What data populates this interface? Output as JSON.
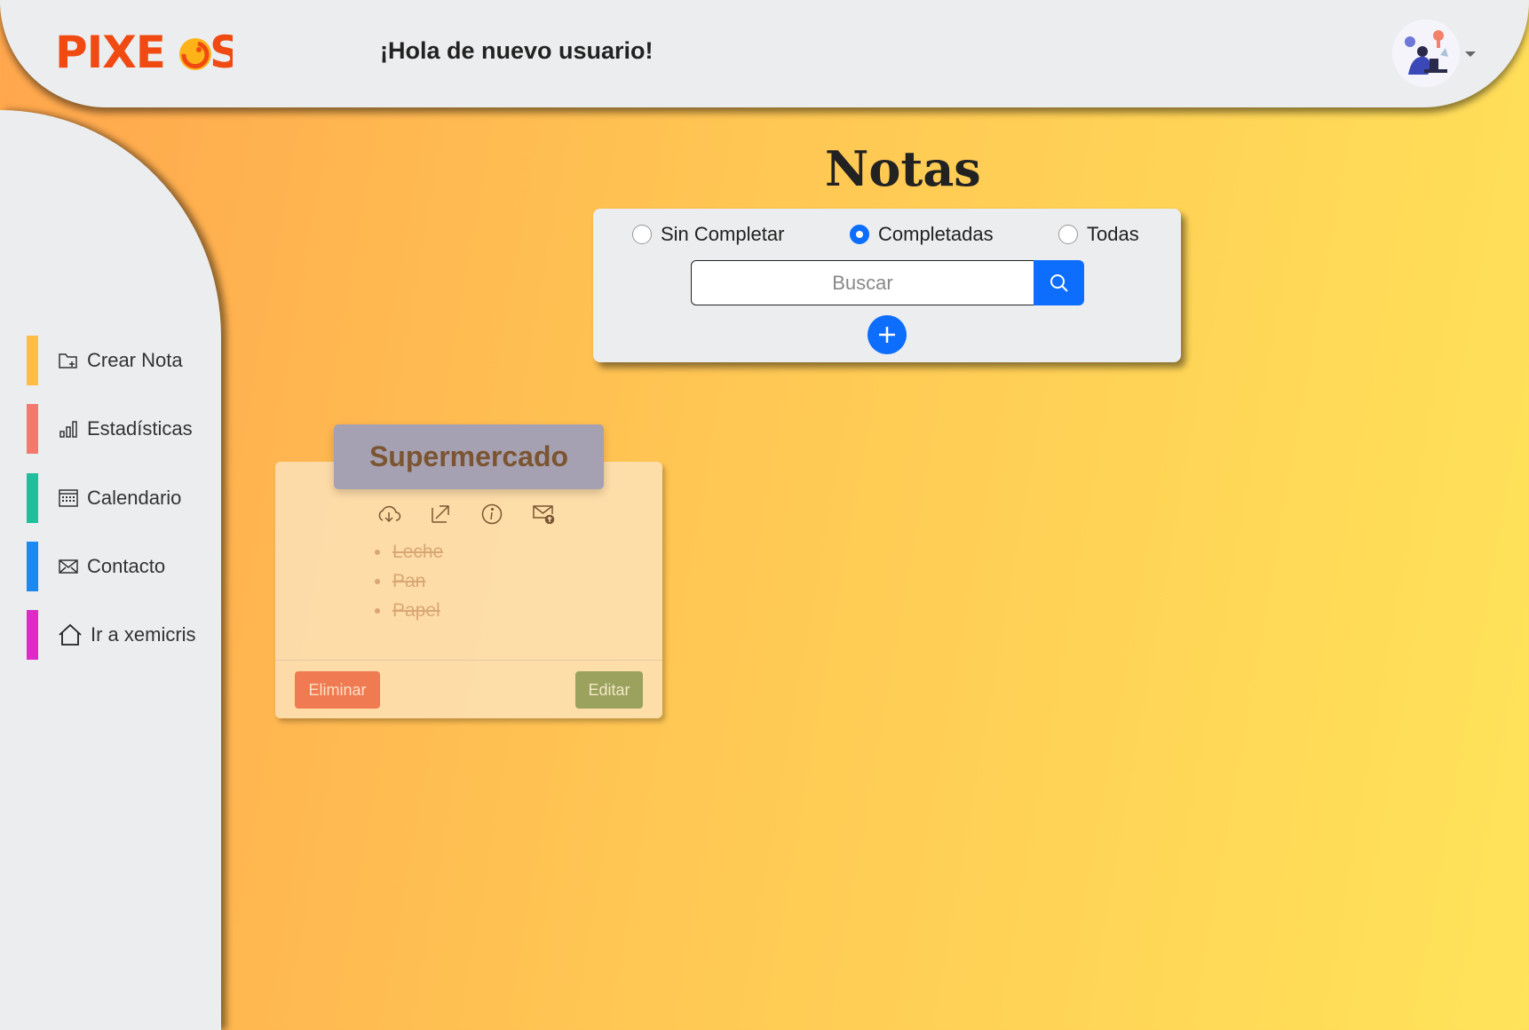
{
  "header": {
    "logo_text": "PIXEOS",
    "greeting": "¡Hola de nuevo usuario!",
    "avatar_icon": "user-illustration-avatar"
  },
  "sidebar": {
    "items": [
      {
        "label": "Crear Nota",
        "icon": "folder-plus-icon",
        "color": "#ffbd45"
      },
      {
        "label": "Estadísticas",
        "icon": "bar-chart-icon",
        "color": "#f4786e"
      },
      {
        "label": "Calendario",
        "icon": "calendar-icon",
        "color": "#1fbf9c"
      },
      {
        "label": "Contacto",
        "icon": "envelope-icon",
        "color": "#1a8af2"
      },
      {
        "label": "Ir a xemicris",
        "icon": "house-icon",
        "color": "#e02ac6"
      }
    ]
  },
  "main": {
    "title": "Notas",
    "filters": [
      {
        "label": "Sin Completar",
        "checked": false
      },
      {
        "label": "Completadas",
        "checked": true
      },
      {
        "label": "Todas",
        "checked": false
      }
    ],
    "search": {
      "placeholder": "Buscar",
      "value": ""
    }
  },
  "note": {
    "title": "Supermercado",
    "items": [
      "Leche",
      "Pan",
      "Papel"
    ],
    "tools": [
      "cloud-download-icon",
      "share-arrow-icon",
      "info-icon",
      "mail-upload-icon"
    ],
    "delete_label": "Eliminar",
    "edit_label": "Editar"
  },
  "colors": {
    "accent": "#0d6efd",
    "logo": "#f04a12",
    "delete": "#f07a51",
    "edit": "#9aa25e"
  }
}
